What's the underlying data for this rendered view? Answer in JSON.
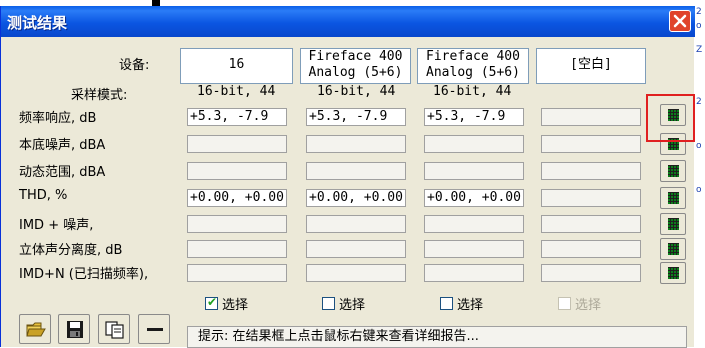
{
  "window": {
    "title": "测试结果"
  },
  "labels": {
    "devices": "设备:",
    "sampling": "采样模式:",
    "rows": [
      "频率响应, dB",
      "本底噪声, dBA",
      "动态范围, dBA",
      "THD, %",
      "IMD + 噪声,",
      "立体声分离度, dB",
      "IMD+N (已扫描频率),"
    ]
  },
  "devices": [
    {
      "line1": "16",
      "line2": ""
    },
    {
      "line1": "Fireface 400",
      "line2": "Analog (5+6)"
    },
    {
      "line1": "Fireface 400",
      "line2": "Analog (5+6)"
    },
    {
      "line1": "[空白]",
      "line2": ""
    }
  ],
  "sampling_modes": [
    "16-bit, 44",
    "16-bit, 44",
    "16-bit, 44",
    ""
  ],
  "results": [
    [
      "+5.3, -7.9",
      "+5.3, -7.9",
      "+5.3, -7.9",
      ""
    ],
    [
      "",
      "",
      "",
      ""
    ],
    [
      "",
      "",
      "",
      ""
    ],
    [
      "+0.00, +0.00",
      "+0.00, +0.00",
      "+0.00, +0.00",
      ""
    ],
    [
      "",
      "",
      "",
      ""
    ],
    [
      "",
      "",
      "",
      ""
    ],
    [
      "",
      "",
      "",
      ""
    ]
  ],
  "row_buttons": [
    "graph-icon",
    "graph-icon",
    "graph-icon",
    "graph-icon",
    "graph-icon",
    "graph-icon",
    "graph-icon"
  ],
  "select_checkboxes": [
    {
      "label": "选择",
      "checked": true,
      "enabled": true
    },
    {
      "label": "选择",
      "checked": false,
      "enabled": true
    },
    {
      "label": "选择",
      "checked": false,
      "enabled": true
    },
    {
      "label": "选择",
      "checked": false,
      "enabled": false
    }
  ],
  "toolbar": [
    "open-folder-icon",
    "save-icon",
    "copy-icon",
    "minus-icon"
  ],
  "hint": "提示: 在结果框上点击鼠标右键来查看详细报告...",
  "colors": {
    "titlebar": "#0a5fe8",
    "close": "#e0432b",
    "highlight": "#e02020",
    "dialog_bg": "#ece9d8"
  }
}
